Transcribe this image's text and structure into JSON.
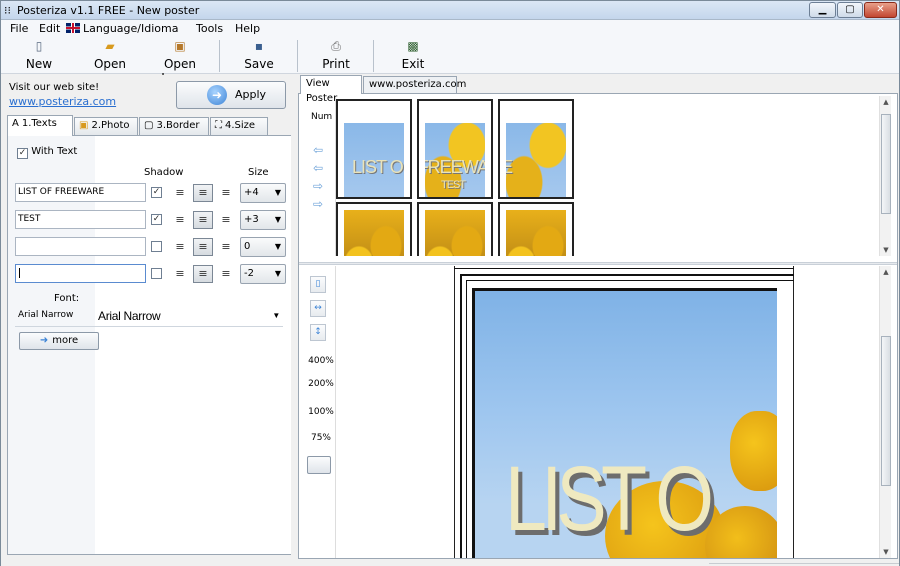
{
  "window": {
    "title": "Posteriza v1.1 FREE - New poster",
    "minimize": "▁",
    "maximize": "▢",
    "close": "✕"
  },
  "menu": [
    "File",
    "Edit",
    "Language/Idioma",
    "Tools",
    "Help"
  ],
  "toolbar": {
    "new": "New",
    "open": "Open",
    "open_image": "Open Image",
    "save": "Save",
    "print": "Print",
    "exit": "Exit"
  },
  "left": {
    "visit_text": "Visit our web site!",
    "site_link": "www.posteriza.com",
    "apply": "Apply",
    "tabs": [
      "1.Texts",
      "2.Photo",
      "3.Border",
      "4.Size"
    ],
    "with_text": "With Text",
    "with_text_checked": true,
    "shadow_header": "Shadow",
    "size_header": "Size",
    "text_rows": [
      {
        "value": "LIST OF FREEWARE",
        "shadow": true,
        "align": "center",
        "size": "+4"
      },
      {
        "value": "TEST",
        "shadow": true,
        "align": "center",
        "size": "+3"
      },
      {
        "value": "",
        "shadow": false,
        "align": "center",
        "size": "0"
      },
      {
        "value": "",
        "shadow": false,
        "align": "center",
        "size": "-2"
      }
    ],
    "font_label": "Font:",
    "font_name_small": "Arial Narrow",
    "font_selected": "Arial Narrow",
    "more": "more"
  },
  "right": {
    "tabs": [
      "View Poster",
      "www.posteriza.com"
    ],
    "num_label": "Num",
    "poster_title": "LIST OF FREEWARE",
    "poster_subtitle": "TEST",
    "poster_big_title": "LIST O",
    "zoom_levels": [
      "400%",
      "200%",
      "100%",
      "75%"
    ]
  },
  "colors": {
    "link": "#2a6fd0",
    "sky": "#8ab8e8",
    "flower": "#f2c522"
  },
  "icons": {
    "new": "document-icon",
    "open": "folder-open-icon",
    "open_image": "image-icon",
    "save": "floppy-disk-icon",
    "print": "printer-icon",
    "exit": "exit-icon"
  }
}
